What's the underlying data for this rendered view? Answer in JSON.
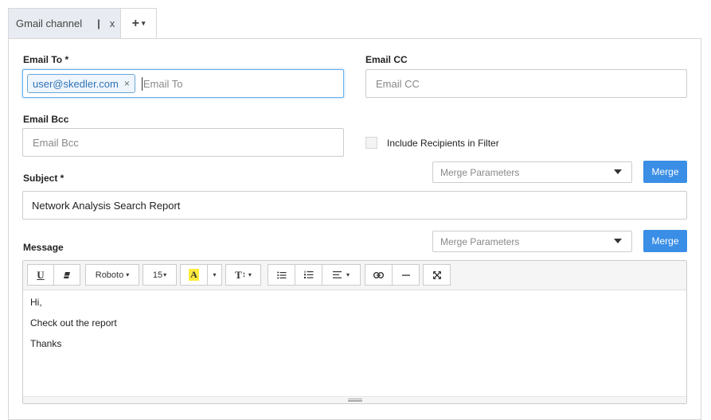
{
  "tabs": [
    {
      "label": "Gmail channel",
      "separator": "|",
      "close": "x"
    }
  ],
  "add_tab": {
    "plus": "+",
    "caret": "▾"
  },
  "email_to": {
    "label": "Email To *",
    "chips": [
      "user@skedler.com"
    ],
    "chip_remove": "×",
    "placeholder": "Email To"
  },
  "email_cc": {
    "label": "Email CC",
    "placeholder": "Email CC"
  },
  "email_bcc": {
    "label": "Email Bcc",
    "placeholder": "Email Bcc"
  },
  "include_recipients": {
    "label": "Include Recipients in Filter",
    "checked": false
  },
  "subject": {
    "label": "Subject *",
    "value": "Network Analysis Search Report",
    "merge_placeholder": "Merge Parameters",
    "merge_button": "Merge"
  },
  "message": {
    "label": "Message",
    "merge_placeholder": "Merge Parameters",
    "merge_button": "Merge",
    "toolbar": {
      "underline": "U",
      "font_family": "Roboto",
      "font_size": "15",
      "highlight": "A",
      "text_size": "T",
      "caret": "▾"
    },
    "lines": [
      "Hi,",
      "Check out the report",
      "Thanks"
    ]
  },
  "colors": {
    "accent": "#3a8ee6",
    "chip_text": "#2f73b6",
    "highlight": "#ffeb3b"
  }
}
